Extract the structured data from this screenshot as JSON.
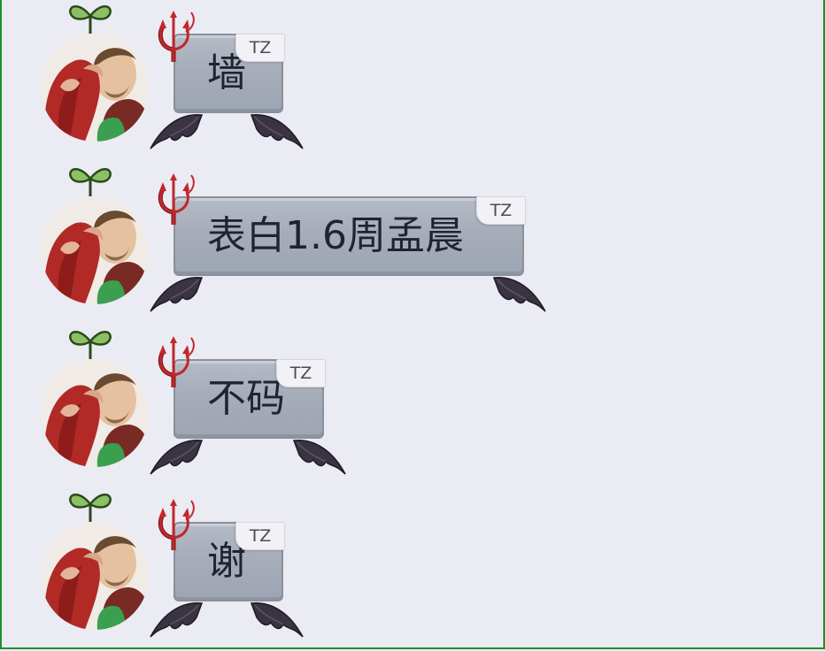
{
  "messages": [
    {
      "text": "墙",
      "tag": "TZ"
    },
    {
      "text": "表白1.6周孟晨",
      "tag": "TZ"
    },
    {
      "text": "不码",
      "tag": "TZ"
    },
    {
      "text": "谢",
      "tag": "TZ"
    }
  ],
  "colors": {
    "background": "#ebebf3",
    "frame_border": "#1f8f2a",
    "bubble": "#a6adb9",
    "tag_bg": "#f2f2f6",
    "devil_red": "#b2262a",
    "sprout_green": "#8cc063"
  }
}
